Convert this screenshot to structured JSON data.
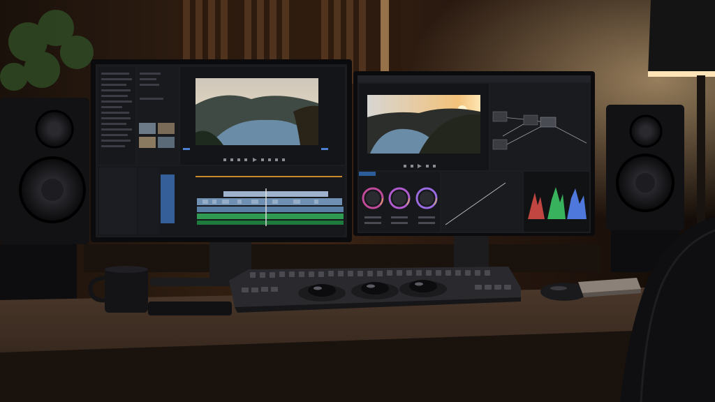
{
  "scene": {
    "palette": {
      "wall_dark": "#140d08",
      "wall_warm": "#3a2414",
      "wood_slat": "#5a3a22",
      "desk_top": "#3b2c22",
      "desk_edge": "#1a120d",
      "bezel": "#0b0b0d",
      "panel_bg": "#1b1c20",
      "panel_line": "#2a2b31",
      "timeline_blue": "#6f8fb3",
      "timeline_green": "#2e9a52",
      "accent_orange": "#c88a2a",
      "lamp_glow": "#ffd9a0",
      "sky": "#d9d1c4",
      "water": "#6b8ca6",
      "sunset": "#f3c27a",
      "wheel_red": "#e04b4b",
      "wheel_green": "#3cc46a",
      "wheel_blue": "#4a6fe0",
      "scope_red": "#e0504a",
      "scope_green": "#3fcf6a",
      "scope_blue": "#5a8bff",
      "plant": "#2f4a24",
      "speaker": "#121214",
      "keyboard": "#2a2a2e",
      "mug": "#141416",
      "mouse": "#1a1a1c",
      "hdd": "#8b8178"
    }
  }
}
